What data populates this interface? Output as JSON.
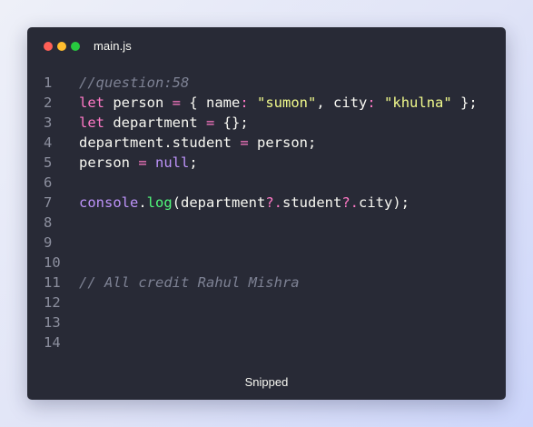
{
  "window": {
    "filename": "main.js",
    "footer": "Snipped"
  },
  "code": {
    "lines": [
      {
        "number": "1",
        "tokens": [
          {
            "t": "//question:58",
            "c": "comment"
          }
        ]
      },
      {
        "number": "2",
        "tokens": [
          {
            "t": "let",
            "c": "keyword"
          },
          {
            "t": " person ",
            "c": "punct"
          },
          {
            "t": "=",
            "c": "op"
          },
          {
            "t": " { name",
            "c": "punct"
          },
          {
            "t": ":",
            "c": "op"
          },
          {
            "t": " ",
            "c": "punct"
          },
          {
            "t": "\"sumon\"",
            "c": "string"
          },
          {
            "t": ", city",
            "c": "punct"
          },
          {
            "t": ":",
            "c": "op"
          },
          {
            "t": " ",
            "c": "punct"
          },
          {
            "t": "\"khulna\"",
            "c": "string"
          },
          {
            "t": " };",
            "c": "punct"
          }
        ]
      },
      {
        "number": "3",
        "tokens": [
          {
            "t": "let",
            "c": "keyword"
          },
          {
            "t": " department ",
            "c": "punct"
          },
          {
            "t": "=",
            "c": "op"
          },
          {
            "t": " {};",
            "c": "punct"
          }
        ]
      },
      {
        "number": "4",
        "tokens": [
          {
            "t": "department.student ",
            "c": "punct"
          },
          {
            "t": "=",
            "c": "op"
          },
          {
            "t": " person;",
            "c": "punct"
          }
        ]
      },
      {
        "number": "5",
        "tokens": [
          {
            "t": "person ",
            "c": "punct"
          },
          {
            "t": "=",
            "c": "op"
          },
          {
            "t": " ",
            "c": "punct"
          },
          {
            "t": "null",
            "c": "null"
          },
          {
            "t": ";",
            "c": "punct"
          }
        ]
      },
      {
        "number": "6",
        "tokens": []
      },
      {
        "number": "7",
        "tokens": [
          {
            "t": "console",
            "c": "builtin"
          },
          {
            "t": ".",
            "c": "punct"
          },
          {
            "t": "log",
            "c": "func"
          },
          {
            "t": "(department",
            "c": "punct"
          },
          {
            "t": "?.",
            "c": "op"
          },
          {
            "t": "student",
            "c": "punct"
          },
          {
            "t": "?.",
            "c": "op"
          },
          {
            "t": "city);",
            "c": "punct"
          }
        ]
      },
      {
        "number": "8",
        "tokens": []
      },
      {
        "number": "9",
        "tokens": []
      },
      {
        "number": "10",
        "tokens": []
      },
      {
        "number": "11",
        "tokens": [
          {
            "t": "// All credit Rahul Mishra",
            "c": "comment"
          }
        ]
      },
      {
        "number": "12",
        "tokens": []
      },
      {
        "number": "13",
        "tokens": []
      },
      {
        "number": "14",
        "tokens": []
      }
    ]
  },
  "colors": {
    "background": "#282a36",
    "keyword": "#ff79c6",
    "string": "#f1fa8c",
    "null": "#bd93f9",
    "function": "#50fa7b",
    "comment": "#7e8294",
    "red_dot": "#ff5f56",
    "yellow_dot": "#ffbd2e",
    "green_dot": "#27c93f"
  }
}
